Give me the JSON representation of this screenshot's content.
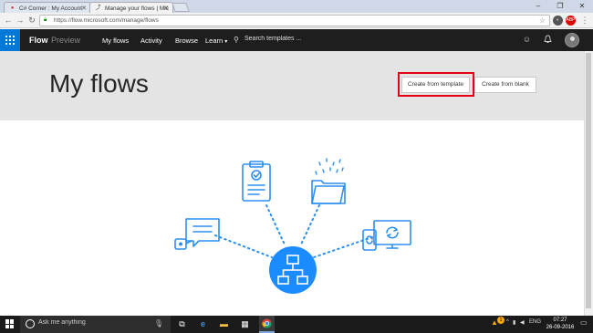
{
  "browser": {
    "tabs": [
      {
        "title": "C# Corner : My Account",
        "icon": "csharp-icon"
      },
      {
        "title": "Manage your flows | Mic",
        "icon": "flow-icon"
      }
    ],
    "address": "https://flow.microsoft.com/manage/flows",
    "window_controls": {
      "minimize": "–",
      "maximize": "❐",
      "close": "✕"
    }
  },
  "header": {
    "brand": "Flow",
    "brand_sub": "Preview",
    "nav": [
      "My flows",
      "Activity",
      "Browse",
      "Learn"
    ],
    "learn_chevron": "▾",
    "search_placeholder": "Search templates ..."
  },
  "hero": {
    "title": "My flows",
    "create_from_template": "Create from template",
    "create_from_blank": "Create from blank"
  },
  "illustration": {
    "accent_color": "#2b8fef",
    "hub_color": "#1a8cff"
  },
  "taskbar": {
    "search_placeholder": "Ask me anything",
    "notification_count": "1",
    "language": "ENG",
    "time": "07:27",
    "date": "26-09-2016"
  },
  "colors": {
    "flow_header": "#1e1e1e",
    "waffle": "#0078d7",
    "hero_bg": "#e4e4e4",
    "highlight": "#e60012"
  }
}
